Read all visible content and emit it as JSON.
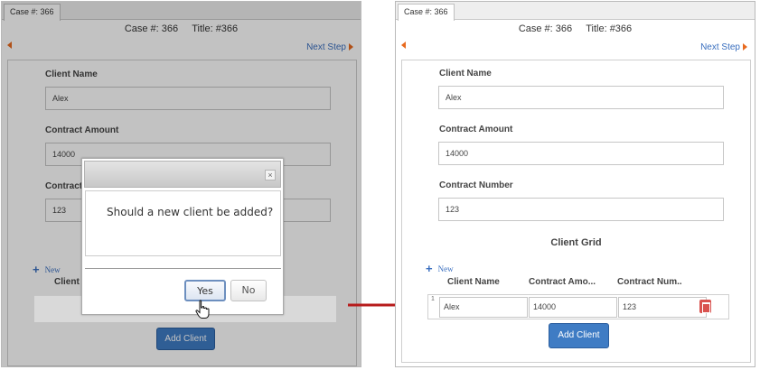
{
  "arrow_color": "#b71c1c",
  "left": {
    "tab": "Case #: 366",
    "case_label": "Case #: 366",
    "title_label": "Title: #366",
    "next_step": "Next Step",
    "fields": [
      {
        "label": "Client Name",
        "value": "Alex"
      },
      {
        "label": "Contract Amount",
        "value": "14000"
      },
      {
        "label": "Contract",
        "value": "123"
      }
    ],
    "new_label": "New",
    "grid_col_partial": "Client N",
    "add_client": "Add Client",
    "dialog": {
      "message": "Should a new client be added?",
      "close_icon": "×",
      "yes": "Yes",
      "no": "No"
    }
  },
  "right": {
    "tab": "Case #: 366",
    "case_label": "Case #: 366",
    "title_label": "Title: #366",
    "next_step": "Next Step",
    "fields": [
      {
        "label": "Client Name",
        "value": "Alex"
      },
      {
        "label": "Contract Amount",
        "value": "14000"
      },
      {
        "label": "Contract Number",
        "value": "123"
      }
    ],
    "grid_title": "Client Grid",
    "new_label": "New",
    "columns": [
      "Client Name",
      "Contract Amo...",
      "Contract Num.."
    ],
    "rows": [
      {
        "num": "1",
        "client_name": "Alex",
        "contract_amount": "14000",
        "contract_number": "123"
      }
    ],
    "add_client": "Add Client"
  }
}
